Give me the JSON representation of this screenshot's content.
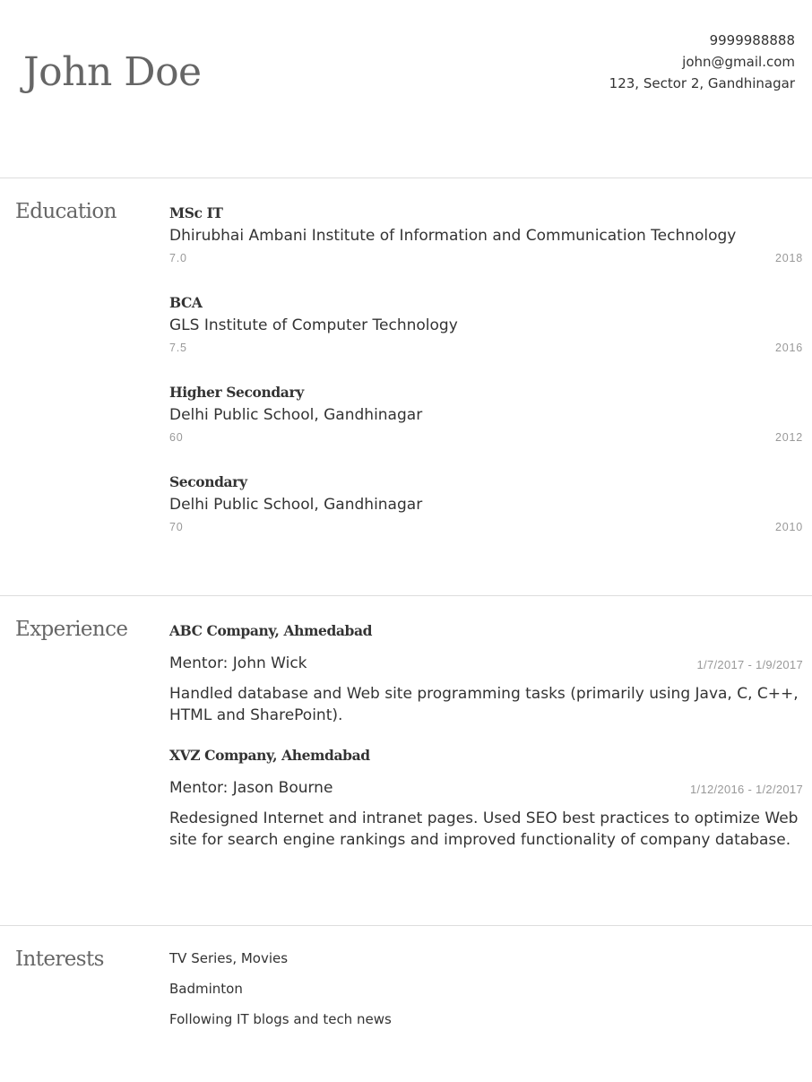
{
  "header": {
    "name": "John Doe",
    "phone": "9999988888",
    "email": "john@gmail.com",
    "address": "123, Sector 2, Gandhinagar"
  },
  "education": {
    "title": "Education",
    "items": [
      {
        "degree": "MSc IT",
        "school": "Dhirubhai Ambani Institute of Information and Communication Technology",
        "grade": "7.0",
        "year": "2018"
      },
      {
        "degree": "BCA",
        "school": "GLS Institute of Computer Technology",
        "grade": "7.5",
        "year": "2016"
      },
      {
        "degree": "Higher Secondary",
        "school": "Delhi Public School, Gandhinagar",
        "grade": "60",
        "year": "2012"
      },
      {
        "degree": "Secondary",
        "school": "Delhi Public School, Gandhinagar",
        "grade": "70",
        "year": "2010"
      }
    ]
  },
  "experience": {
    "title": "Experience",
    "items": [
      {
        "company": "ABC Company, Ahmedabad",
        "mentor": "Mentor: John Wick",
        "dates": "1/7/2017 - 1/9/2017",
        "description": "Handled database and Web site programming tasks (primarily using Java, C, C++, HTML and SharePoint)."
      },
      {
        "company": "XVZ Company, Ahemdabad",
        "mentor": "Mentor: Jason Bourne",
        "dates": "1/12/2016 - 1/2/2017",
        "description": "Redesigned Internet and intranet pages. Used SEO best practices to optimize Web site for search engine rankings and improved functionality of company database."
      }
    ]
  },
  "interests": {
    "title": "Interests",
    "items": [
      "TV Series, Movies",
      "Badminton",
      "Following IT blogs and tech news"
    ]
  }
}
